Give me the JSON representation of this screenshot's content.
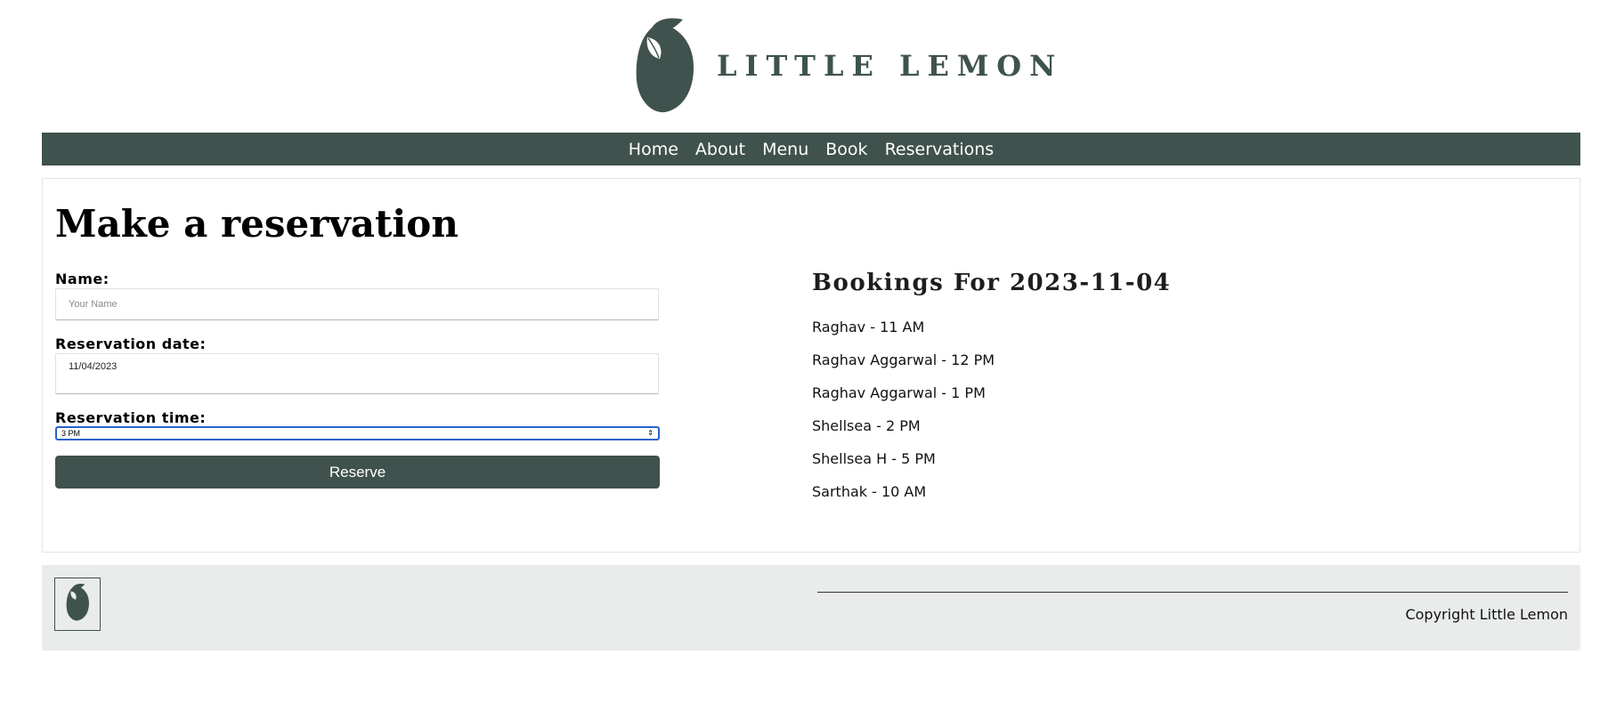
{
  "header": {
    "brand": "LITTLE LEMON",
    "logo_icon": "lemon-icon",
    "brand_color": "#40524d"
  },
  "nav": {
    "items": [
      "Home",
      "About",
      "Menu",
      "Book",
      "Reservations"
    ]
  },
  "form": {
    "title": "Make a reservation",
    "name_label": "Name:",
    "name_placeholder": "Your Name",
    "date_label": "Reservation date:",
    "date_value": "11/04/2023",
    "time_label": "Reservation time:",
    "time_value": "3 PM",
    "reserve_label": "Reserve"
  },
  "bookings": {
    "title": "Bookings For 2023-11-04",
    "items": [
      "Raghav - 11 AM",
      "Raghav Aggarwal - 12 PM",
      "Raghav Aggarwal - 1 PM",
      "Shellsea - 2 PM",
      "Shellsea H - 5 PM",
      "Sarthak - 10 AM"
    ]
  },
  "footer": {
    "logo_icon": "lemon-icon",
    "copyright": "Copyright Little Lemon",
    "background": "#e9eceb"
  }
}
